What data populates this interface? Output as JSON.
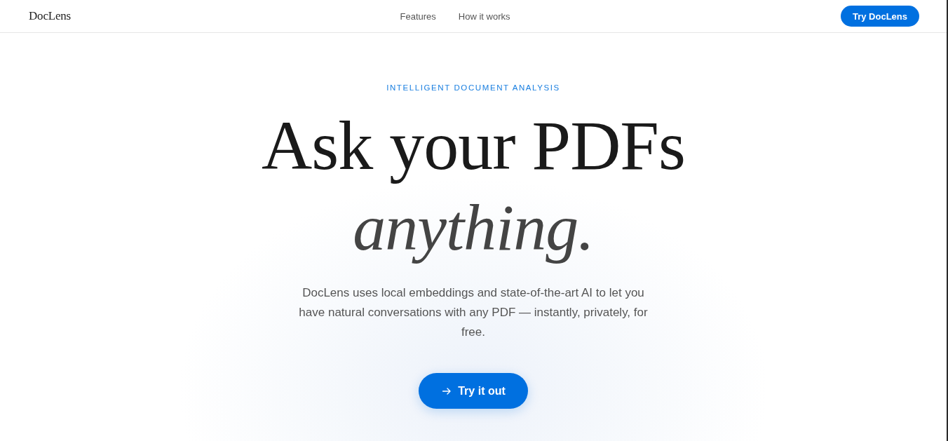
{
  "header": {
    "logo": "DocLens",
    "nav_links": [
      {
        "label": "Features"
      },
      {
        "label": "How it works"
      }
    ],
    "cta_button": "Try DocLens"
  },
  "hero": {
    "eyebrow": "INTELLIGENT DOCUMENT ANALYSIS",
    "headline": "Ask your PDFs",
    "headline_emphasis": "anything.",
    "description": "DocLens uses local embeddings and state-of-the-art AI to let you have natural conversations with any PDF — instantly, privately, for free.",
    "primary_button": "Try it out"
  }
}
